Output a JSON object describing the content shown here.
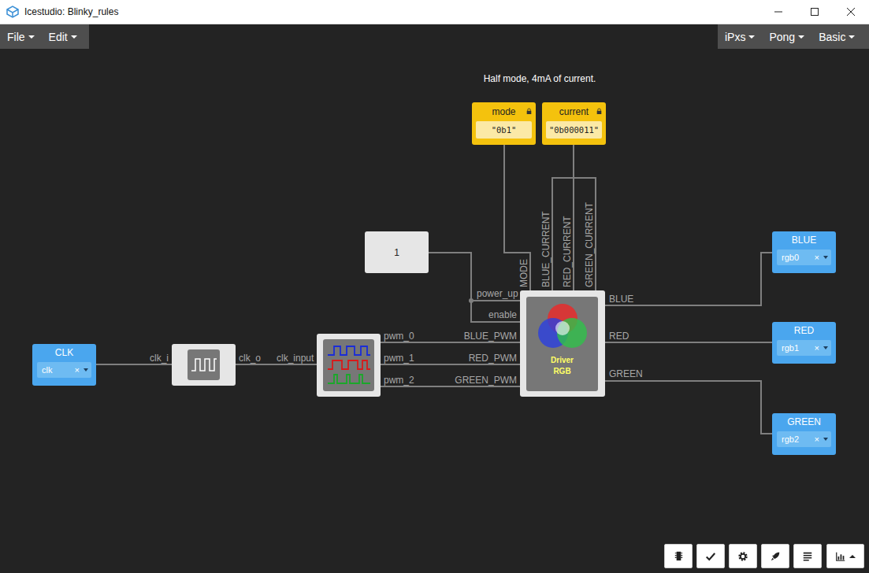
{
  "window": {
    "title": "Icestudio: Blinky_rules"
  },
  "menus": {
    "left": [
      {
        "label": "File"
      },
      {
        "label": "Edit"
      }
    ],
    "right": [
      {
        "label": "iPxs"
      },
      {
        "label": "Pong"
      },
      {
        "label": "Basic"
      }
    ]
  },
  "comment": "Half mode, 4mA of current.",
  "constants": [
    {
      "name": "mode",
      "value": "\"0b1\"",
      "locked": true
    },
    {
      "name": "current",
      "value": "\"0b000011\"",
      "locked": true
    }
  ],
  "inputs": [
    {
      "name": "CLK",
      "pin": "clk",
      "clear": "×"
    }
  ],
  "outputs": [
    {
      "name": "BLUE",
      "pin": "rgb0",
      "clear": "×"
    },
    {
      "name": "RED",
      "pin": "rgb1",
      "clear": "×"
    },
    {
      "name": "GREEN",
      "pin": "rgb2",
      "clear": "×"
    }
  ],
  "blocks": [
    {
      "kind": "prescaler",
      "inputs": [
        "clk_i"
      ],
      "outputs": [
        "clk_o"
      ]
    },
    {
      "kind": "pwm",
      "inputs": [
        "clk_input"
      ],
      "outputs": [
        "pwm_0",
        "pwm_1",
        "pwm_2"
      ]
    },
    {
      "kind": "constant",
      "value": "1"
    },
    {
      "kind": "driver",
      "title": [
        "Driver",
        "RGB"
      ],
      "inputs": [
        "power_up",
        "enable",
        "BLUE_PWM",
        "RED_PWM",
        "GREEN_PWM"
      ],
      "params": [
        "MODE",
        "BLUE_CURRENT",
        "RED_CURRENT",
        "GREEN_CURRENT"
      ],
      "outputs": [
        "BLUE",
        "RED",
        "GREEN"
      ]
    }
  ]
}
